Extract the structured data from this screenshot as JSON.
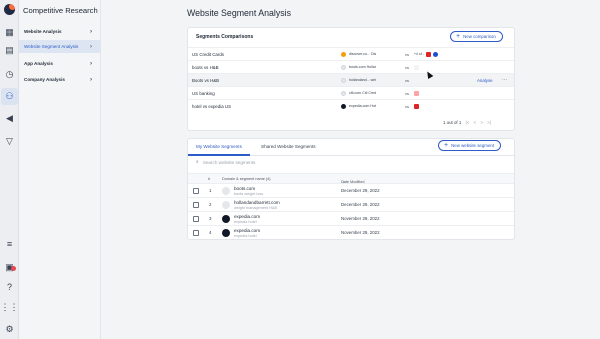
{
  "sidebar": {
    "title": "Competitive Research",
    "items": [
      {
        "label": "Website Analysis",
        "active": false
      },
      {
        "label": "Website Segment Analysis",
        "active": true
      },
      {
        "label": "App Analysis",
        "active": false
      },
      {
        "label": "Company Analysis",
        "active": false
      }
    ]
  },
  "page": {
    "title": "Website Segment Analysis"
  },
  "comparisons": {
    "title": "Segments Comparisons",
    "new_label": "New comparison",
    "analyse_label": "Analyse",
    "rows": [
      {
        "name": "US Credit Cards",
        "seg": "discover.co... Discover - ...",
        "color": "#f59e0b",
        "vs": "vs",
        "extra": "+4 of..."
      },
      {
        "name": "boots vs H&B",
        "seg": "boots.com Hollandand...",
        "color": "#e5e7eb",
        "vs": "vs",
        "extra": ""
      },
      {
        "name": "Boots vs H&B",
        "seg": "hollandand... weight ma...",
        "color": "#e5e7eb",
        "vs": "vs",
        "extra": ""
      },
      {
        "name": "US banking",
        "seg": "citi.com Citi Credit ...",
        "color": "#e5e7eb",
        "vs": "vs",
        "extra": ""
      },
      {
        "name": "hotel vs expedia US",
        "seg": "expedia.com Hotels on E...",
        "color": "#111827",
        "vs": "vs",
        "extra": ""
      }
    ],
    "pager": "1 out of 1"
  },
  "segments": {
    "tab_my": "My Website Segments",
    "tab_shared": "Shared Website Segments",
    "new_label": "New website segment",
    "search_placeholder": "Search website segments",
    "col_num": "#",
    "col_domain": "Domain & segment name (4)",
    "col_date": "Date Modified",
    "rows": [
      {
        "num": "1",
        "domain": "boots.com",
        "segment": "boots weight loss",
        "date": "December 29, 2022",
        "color": "#e5e7eb"
      },
      {
        "num": "2",
        "domain": "hollandandbarrett.com",
        "segment": "weight management H&B",
        "date": "December 29, 2022",
        "color": "#e5e7eb"
      },
      {
        "num": "3",
        "domain": "expedia.com",
        "segment": "expedia hotel",
        "date": "November 29, 2022",
        "color": "#111827"
      },
      {
        "num": "4",
        "domain": "expedia.com",
        "segment": "expedia hotel",
        "date": "November 29, 2022",
        "color": "#111827"
      }
    ]
  },
  "icons": {
    "chevron": "›",
    "plus": "+",
    "search": "⌕",
    "more": "···",
    "sort": "↓"
  },
  "colors": {
    "accent": "#2d5bc7",
    "logo": "#ff6b3d"
  }
}
